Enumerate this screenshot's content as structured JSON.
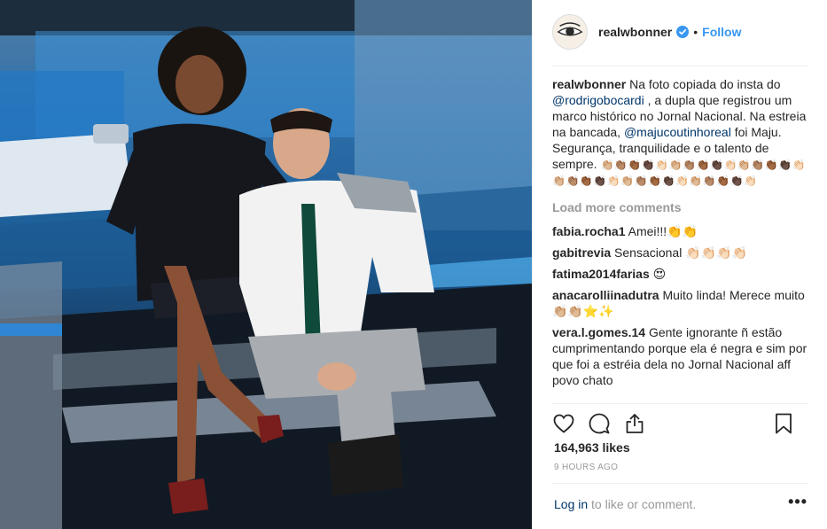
{
  "header": {
    "username": "realwbonner",
    "separator": "•",
    "follow_label": "Follow"
  },
  "caption": {
    "username": "realwbonner",
    "text_1": " Na foto copiada do insta do ",
    "mention_1": "@rodrigobocardi",
    "text_2": " , a dupla que registrou um marco histórico no Jornal Nacional. Na estreia na bancada, ",
    "mention_2": "@majucoutinhoreal",
    "text_3": " foi Maju. Segurança, tranquilidade e o talento de sempre. ",
    "emojis": "👏🏼👏🏽👏🏾👏🏿👏🏻👏🏼👏🏽👏🏾👏🏿👏🏻👏🏼👏🏽👏🏾👏🏿👏🏻👏🏼👏🏽👏🏾👏🏿👏🏻👏🏼👏🏽👏🏾👏🏿👏🏻👏🏼👏🏽👏🏾👏🏿👏🏻"
  },
  "load_more_label": "Load more comments",
  "comments": [
    {
      "username": "fabia.rocha1",
      "text": " Amei!!!👏👏"
    },
    {
      "username": "gabitrevia",
      "text": " Sensacional 👏🏻👏🏻👏🏻👏🏻"
    },
    {
      "username": "fatima2014farias",
      "text": " 😍"
    },
    {
      "username": "anacarolliinadutra",
      "text": " Muito linda! Merece muito 👏🏼👏🏼⭐✨"
    },
    {
      "username": "vera.l.gomes.14",
      "text": " Gente ignorante ñ estão cumprimentando porque ela é negra e sim por que foi a estréia dela no Jornal Nacional aff povo chato"
    }
  ],
  "likes": "164,963 likes",
  "timestamp": "9 HOURS AGO",
  "footer": {
    "login_label": "Log in",
    "login_suffix": " to like or comment.",
    "more_label": "•••"
  },
  "icons": {
    "like": "heart-icon",
    "comment": "comment-bubble-icon",
    "share": "share-icon",
    "save": "bookmark-icon",
    "verified": "verified-badge-icon"
  },
  "colors": {
    "link_blue": "#3897f0",
    "mention_blue": "#003569",
    "muted": "#999999"
  }
}
